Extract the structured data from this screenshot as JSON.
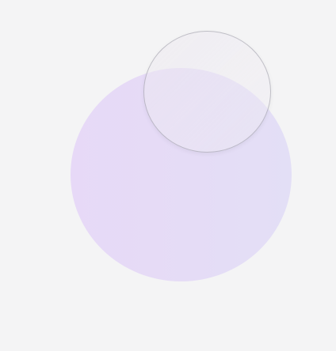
{
  "canvas": {
    "background_color": "#f4f4f5"
  },
  "shapes": {
    "large_circle": {
      "fill_color": "#e6dbf7"
    },
    "small_circle": {
      "fill_color": "#ece8f0",
      "stroke_color": "#9a9aa5"
    }
  }
}
